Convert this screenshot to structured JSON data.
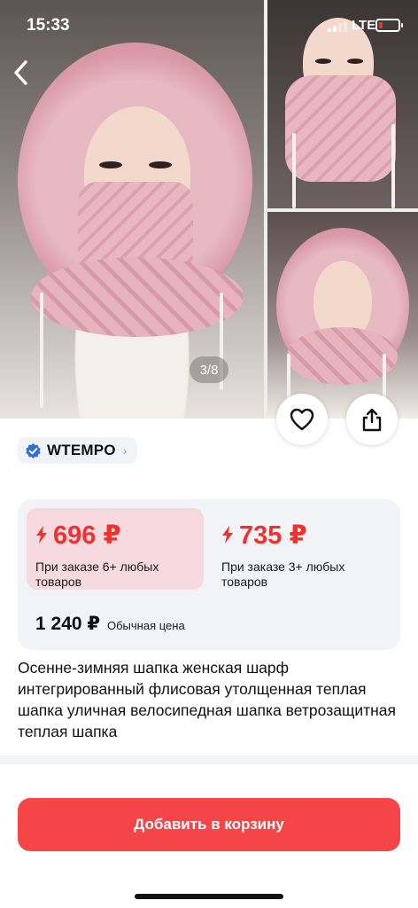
{
  "status_bar": {
    "time": "15:33",
    "network": "LTE",
    "battery_color": "#e0392d"
  },
  "gallery": {
    "counter": "3/8",
    "hood_color": "#e7b9c2",
    "icons": {
      "back": "chevron-left-icon",
      "favorite": "heart-icon",
      "share": "share-icon"
    }
  },
  "seller": {
    "name": "WTEMPO",
    "badge_icon": "verified-check-icon",
    "badge_color": "#2f6fd6"
  },
  "prices": {
    "tiers": [
      {
        "price": "696 ₽",
        "condition": "При заказе 6+ любых товаров"
      },
      {
        "price": "735 ₽",
        "condition": "При заказе 3+ любых товаров"
      }
    ],
    "regular_price": "1 240 ₽",
    "regular_label": "Обычная цена",
    "accent_color": "#f2312e"
  },
  "product": {
    "title": "Осенне-зимняя шапка женская шарф интегрированный флисовая утолщенная теплая шапка уличная велосипедная шапка ветрозащитная теплая шапка"
  },
  "actions": {
    "add_to_cart": "Добавить в корзину",
    "button_color": "#f54548"
  }
}
